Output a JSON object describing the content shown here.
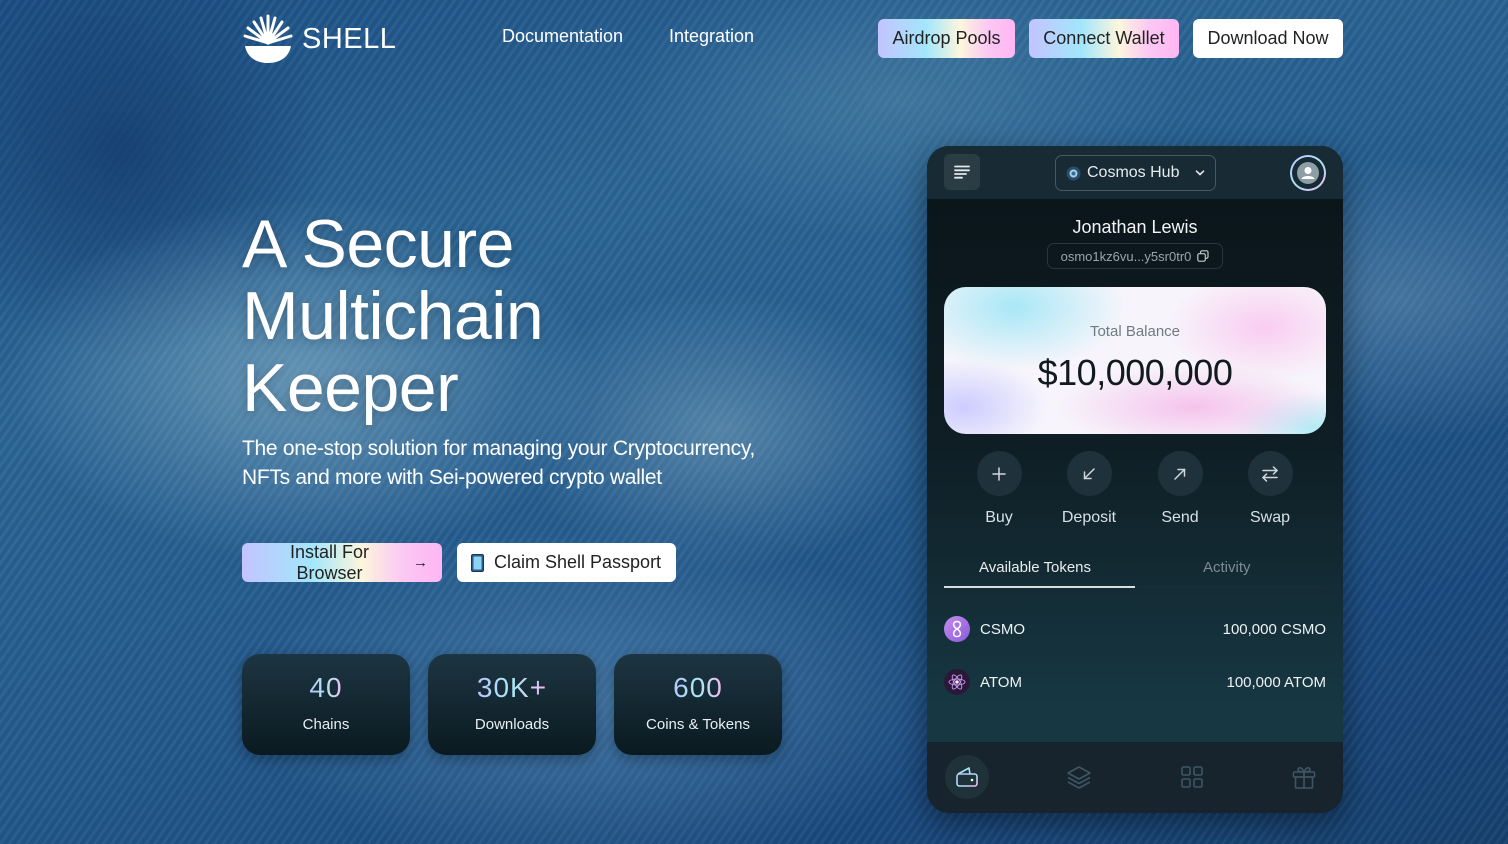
{
  "header": {
    "logo_text": "SHELL",
    "nav": [
      {
        "label": "Documentation"
      },
      {
        "label": "Integration"
      }
    ],
    "buttons": [
      {
        "label": "Airdrop Pools"
      },
      {
        "label": "Connect Wallet"
      },
      {
        "label": "Download Now"
      }
    ]
  },
  "hero": {
    "title_lines": [
      "A Secure",
      "Multichain",
      "Keeper"
    ],
    "subtitle": "The one-stop solution for managing your Cryptocurrency, NFTs and more with Sei-powered crypto wallet",
    "cta_primary": "Install For Browser",
    "cta_primary_icon": "arrow-right-icon",
    "cta_secondary": "Claim Shell Passport",
    "cta_secondary_icon": "passport-icon"
  },
  "stats": [
    {
      "value": "40",
      "label": "Chains"
    },
    {
      "value": "30K+",
      "label": "Downloads"
    },
    {
      "value": "600",
      "label": "Coins & Tokens"
    }
  ],
  "wallet": {
    "chain_selector": "Cosmos Hub",
    "user_name": "Jonathan Lewis",
    "address": "osmo1kz6vu...y5sr0tr0",
    "balance_label": "Total Balance",
    "balance_value": "$10,000,000",
    "actions": [
      {
        "label": "Buy",
        "icon": "plus-icon"
      },
      {
        "label": "Deposit",
        "icon": "arrow-down-left-icon"
      },
      {
        "label": "Send",
        "icon": "arrow-up-right-icon"
      },
      {
        "label": "Swap",
        "icon": "swap-icon"
      }
    ],
    "tabs": [
      {
        "label": "Available Tokens",
        "active": true
      },
      {
        "label": "Activity",
        "active": false
      }
    ],
    "tokens": [
      {
        "symbol": "CSMO",
        "amount": "100,000 CSMO"
      },
      {
        "symbol": "ATOM",
        "amount": "100,000 ATOM"
      }
    ],
    "bottom_nav": [
      {
        "icon": "wallet-icon",
        "active": true
      },
      {
        "icon": "layers-icon",
        "active": false
      },
      {
        "icon": "apps-grid-icon",
        "active": false
      },
      {
        "icon": "gift-icon",
        "active": false
      }
    ]
  },
  "colors": {
    "accent_gradient": [
      "#c3c4ff",
      "#a2e6fb",
      "#fdf6dc",
      "#fbc8f3"
    ],
    "wallet_bg": "#0f1e25",
    "card_bg": "#1d3542"
  }
}
